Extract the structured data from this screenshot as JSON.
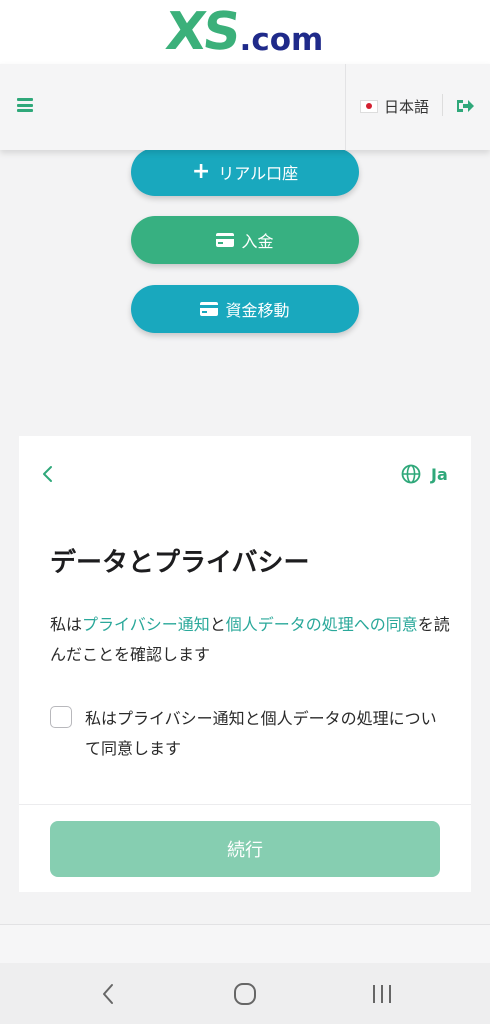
{
  "brand": {
    "logo_xs": "XS",
    "logo_com": ".com"
  },
  "header": {
    "menu_icon": "hamburger-menu-icon",
    "language": "日本語",
    "logout_icon": "logout-icon"
  },
  "actions": {
    "real_account": "リアル口座",
    "deposit": "入金",
    "transfer": "資金移動"
  },
  "consent": {
    "language_short": "Ja",
    "title": "データとプライバシー",
    "para_prefix": "私は",
    "privacy_link": "プライバシー通知",
    "para_and": "と",
    "consent_link": "個人データの処理への同意",
    "para_suffix": "を読んだことを確認します",
    "checkbox_label": "私はプライバシー通知と個人データの処理について同意します",
    "continue_label": "続行"
  },
  "colors": {
    "brand_green": "#3bb07a",
    "brand_navy": "#1f2a8a",
    "teal_button": "#19a8be",
    "green_button": "#37b081",
    "link": "#2aa89a",
    "continue_disabled": "#86ceb1"
  }
}
